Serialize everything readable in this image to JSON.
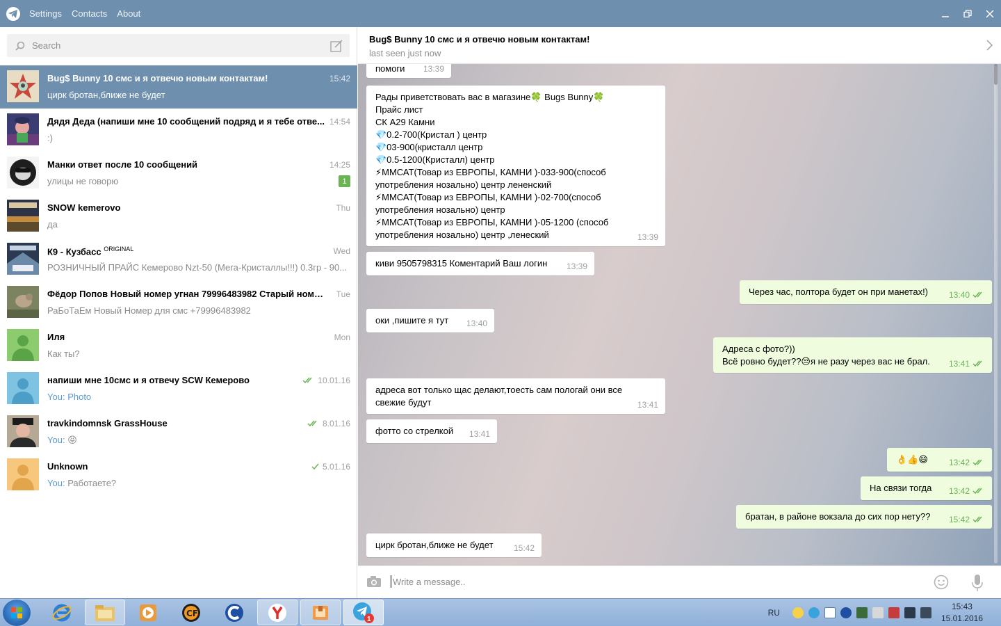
{
  "window": {
    "menu": [
      "Settings",
      "Contacts",
      "About"
    ],
    "controls": [
      "minimize",
      "restore",
      "close"
    ]
  },
  "search": {
    "placeholder": "Search"
  },
  "dialogs": [
    {
      "name": "Bug$ Bunny 10 смс и я отвечю новым контактам!",
      "time": "15:42",
      "message": "цирк бротан,ближе не будет",
      "active": true,
      "avatar": "bunny"
    },
    {
      "name": "Дядя Деда (напиши мне 10 сообщений подряд и я тебе отве...",
      "time": "14:54",
      "message": ":)",
      "avatar": "cartoon"
    },
    {
      "name": "Манки ответ после 10 сообщений",
      "time": "14:25",
      "message": "улицы не говорю",
      "badge": "1",
      "avatar": "monkey"
    },
    {
      "name": "SNOW kemerovo",
      "time": "Thu",
      "message": "да",
      "avatar": "snow"
    },
    {
      "name": "К9 - Кузбасс",
      "name_sup": "ORIGINAL",
      "time": "Wed",
      "message": "РОЗНИЧНЫЙ ПРАЙС  Кемерово Nzt-50 (Мега-Кристаллы!!!) 0.3гр - 90...",
      "avatar": "k9"
    },
    {
      "name": "Фёдор Попов Новый номер угнан 79996483982  Старый номе...",
      "time": "Tue",
      "message": "РаБоТаЕм Новый Номер для смс +79996483982",
      "avatar": "bird"
    },
    {
      "name": "Иля",
      "time": "Mon",
      "message": "Как ты?",
      "avatar": "green"
    },
    {
      "name": "напиши мне 10смс и я отвечу SCW Кемерово",
      "time": "10.01.16",
      "you": "You:",
      "message": "Photo",
      "read": true,
      "avatar": "teal"
    },
    {
      "name": "travkindomnsk GrassHouse",
      "time": "8.01.16",
      "you": "You:",
      "message": "😝",
      "read": true,
      "avatar": "man"
    },
    {
      "name": "Unknown",
      "time": "5.01.16",
      "you": "You:",
      "message": "Работаете?",
      "read": true,
      "avatar": "orange"
    }
  ],
  "chat": {
    "title": "Bug$ Bunny 10 смс и я отвечю новым контактам!",
    "status": "last seen just now",
    "messages": [
      {
        "dir": "in",
        "text": "помоги",
        "time": "13:39"
      },
      {
        "dir": "in",
        "text": "Рады приветствовать вас в магазине🍀 Bugs Bunny🍀\nПрайс лист\nСК А29 Камни\n💎0.2-700(Кристал ) центр\n💎03-900(кристалл центр\n💎0.5-1200(Кристалл)  центр\n⚡ММСАТ(Товар из ЕВРОПЫ, КАМНИ )-033-900(способ употребления нозально) центр лененский\n⚡ММСАТ(Товар из ЕВРОПЫ, КАМНИ )-02-700(способ употребления нозально) центр\n⚡ММСАТ(Товар из ЕВРОПЫ, КАМНИ )-05-1200  (способ употребления нозально) центр ,ленеский",
        "time": "13:39"
      },
      {
        "dir": "in",
        "text": "киви 9505798315 Коментарий Ваш логин",
        "time": "13:39"
      },
      {
        "dir": "out",
        "text": "Через час, полтора будет он при манетах!)",
        "time": "13:40"
      },
      {
        "dir": "in",
        "text": "оки ,пишите я тут",
        "time": "13:40"
      },
      {
        "dir": "out",
        "text": "Адреса с фото?))\nВсё ровно будет??😒я не разу через вас не брал.",
        "time": "13:41"
      },
      {
        "dir": "in",
        "text": "адреса вот только щас делают,тоесть сам пологай они все свежие будут",
        "time": "13:41"
      },
      {
        "dir": "in",
        "text": "фотто со стрелкой",
        "time": "13:41"
      },
      {
        "dir": "out",
        "text": "👌👍😄",
        "time": "13:42"
      },
      {
        "dir": "out",
        "text": "На связи тогда",
        "time": "13:42"
      },
      {
        "dir": "out",
        "text": "братан, в районе вокзала до сих пор нету??",
        "time": "15:42"
      },
      {
        "dir": "in",
        "text": "цирк бротан,ближе не будет",
        "time": "15:42"
      }
    ]
  },
  "compose": {
    "placeholder": "Write a message.."
  },
  "taskbar": {
    "apps": [
      "internet-explorer",
      "explorer",
      "media-player",
      "crossfire",
      "ccleaner",
      "yandex-browser",
      "archive",
      "telegram"
    ],
    "telegram_badge": "1",
    "language": "RU",
    "clock_time": "15:43",
    "clock_date": "15.01.2016"
  },
  "colors": {
    "accent": "#6e8fae",
    "unread_badge": "#6ab455",
    "outgoing_bubble": "#effdde",
    "read_check": "#6ab455"
  }
}
